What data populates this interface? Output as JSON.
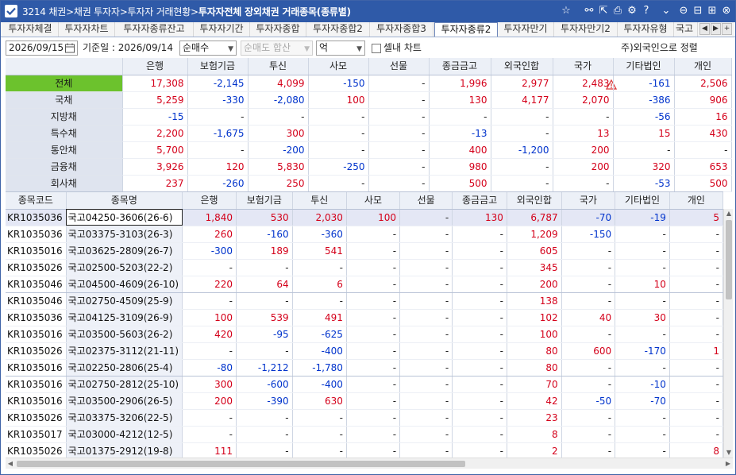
{
  "title": {
    "prefix": "3214 채권>채권 투자자>투자자 거래현황>",
    "bold": "투자자전체 장외채권 거래종목(종류별)"
  },
  "tabs": [
    "투자자체결",
    "투자자차트",
    "투자자종류잔고",
    "투자자기간",
    "투자자종합",
    "투자자종합2",
    "투자자종합3",
    "투자자종류2",
    "투자자만기",
    "투자자만기2",
    "투자자유형",
    "국고"
  ],
  "active_tab": 7,
  "controls": {
    "date": "2026/09/15",
    "base_date_label": "기준일 : 2026/09/14",
    "net_select": "순매수",
    "sum_select": "순매도 합산",
    "unit_select": "억",
    "cell_chart_label": "셀내 차트",
    "note": "주)외국인으로 정렬"
  },
  "columns": [
    "은행",
    "보험기금",
    "투신",
    "사모",
    "선물",
    "종금금고",
    "외국인합",
    "국가",
    "기타법인",
    "개인"
  ],
  "summary_rows": [
    {
      "label": "전체",
      "values": [
        "17,308",
        "-2,145",
        "4,099",
        "-150",
        "-",
        "1,996",
        "2,977",
        "2,483",
        "-161",
        "2,506"
      ]
    },
    {
      "label": "국채",
      "values": [
        "5,259",
        "-330",
        "-2,080",
        "100",
        "-",
        "130",
        "4,177",
        "2,070",
        "-386",
        "906"
      ]
    },
    {
      "label": "지방채",
      "values": [
        "-15",
        "-",
        "-",
        "-",
        "-",
        "-",
        "-",
        "-",
        "-56",
        "16"
      ]
    },
    {
      "label": "특수채",
      "values": [
        "2,200",
        "-1,675",
        "300",
        "-",
        "-",
        "-13",
        "-",
        "13",
        "15",
        "430"
      ]
    },
    {
      "label": "통안채",
      "values": [
        "5,700",
        "-",
        "-200",
        "-",
        "-",
        "400",
        "-1,200",
        "200",
        "-",
        "-"
      ]
    },
    {
      "label": "금융채",
      "values": [
        "3,926",
        "120",
        "5,830",
        "-250",
        "-",
        "980",
        "-",
        "200",
        "320",
        "653"
      ]
    },
    {
      "label": "회사채",
      "values": [
        "237",
        "-260",
        "250",
        "-",
        "-",
        "500",
        "-",
        "-",
        "-53",
        "500"
      ]
    }
  ],
  "detail_headers": [
    "종목코드",
    "종목명",
    "은행",
    "보험기금",
    "투신",
    "사모",
    "선물",
    "종금금고",
    "외국인합",
    "국가",
    "기타법인",
    "개인"
  ],
  "detail_rows": [
    {
      "code": "KR1035036",
      "name": "국고04250-3606(26-6)",
      "values": [
        "1,840",
        "530",
        "2,030",
        "100",
        "-",
        "130",
        "6,787",
        "-70",
        "-19",
        "5"
      ]
    },
    {
      "code": "KR1035036",
      "name": "국고03375-3103(26-3)",
      "values": [
        "260",
        "-160",
        "-360",
        "-",
        "-",
        "-",
        "1,209",
        "-150",
        "-",
        "-"
      ]
    },
    {
      "code": "KR1035016",
      "name": "국고03625-2809(26-7)",
      "values": [
        "-300",
        "189",
        "541",
        "-",
        "-",
        "-",
        "605",
        "-",
        "-",
        "-"
      ]
    },
    {
      "code": "KR1035026",
      "name": "국고02500-5203(22-2)",
      "values": [
        "-",
        "-",
        "-",
        "-",
        "-",
        "-",
        "345",
        "-",
        "-",
        "-"
      ]
    },
    {
      "code": "KR1035046",
      "name": "국고04500-4609(26-10)",
      "values": [
        "220",
        "64",
        "6",
        "-",
        "-",
        "-",
        "200",
        "-",
        "10",
        "-"
      ]
    },
    {
      "code": "KR1035046",
      "name": "국고02750-4509(25-9)",
      "values": [
        "-",
        "-",
        "-",
        "-",
        "-",
        "-",
        "138",
        "-",
        "-",
        "-"
      ]
    },
    {
      "code": "KR1035036",
      "name": "국고04125-3109(26-9)",
      "values": [
        "100",
        "539",
        "491",
        "-",
        "-",
        "-",
        "102",
        "40",
        "30",
        "-"
      ]
    },
    {
      "code": "KR1035016",
      "name": "국고03500-5603(26-2)",
      "values": [
        "420",
        "-95",
        "-625",
        "-",
        "-",
        "-",
        "100",
        "-",
        "-",
        "-"
      ]
    },
    {
      "code": "KR1035026",
      "name": "국고02375-3112(21-11)",
      "values": [
        "-",
        "-",
        "-400",
        "-",
        "-",
        "-",
        "80",
        "600",
        "-170",
        "1"
      ]
    },
    {
      "code": "KR1035016",
      "name": "국고02250-2806(25-4)",
      "values": [
        "-80",
        "-1,212",
        "-1,780",
        "-",
        "-",
        "-",
        "80",
        "-",
        "-",
        "-"
      ]
    },
    {
      "code": "KR1035016",
      "name": "국고02750-2812(25-10)",
      "values": [
        "300",
        "-600",
        "-400",
        "-",
        "-",
        "-",
        "70",
        "-",
        "-10",
        "-"
      ]
    },
    {
      "code": "KR1035016",
      "name": "국고03500-2906(26-5)",
      "values": [
        "200",
        "-390",
        "630",
        "-",
        "-",
        "-",
        "42",
        "-50",
        "-70",
        "-"
      ]
    },
    {
      "code": "KR1035026",
      "name": "국고03375-3206(22-5)",
      "values": [
        "-",
        "-",
        "-",
        "-",
        "-",
        "-",
        "23",
        "-",
        "-",
        "-"
      ]
    },
    {
      "code": "KR1035017",
      "name": "국고03000-4212(12-5)",
      "values": [
        "-",
        "-",
        "-",
        "-",
        "-",
        "-",
        "8",
        "-",
        "-",
        "-"
      ]
    },
    {
      "code": "KR1035026",
      "name": "국고01375-2912(19-8)",
      "values": [
        "111",
        "-",
        "-",
        "-",
        "-",
        "-",
        "2",
        "-",
        "-",
        "8"
      ]
    }
  ],
  "colors": {
    "title_bar": "#2f5aa8",
    "positive": "#d4001a",
    "negative": "#0033cc",
    "total_row": "#6cc22d"
  }
}
